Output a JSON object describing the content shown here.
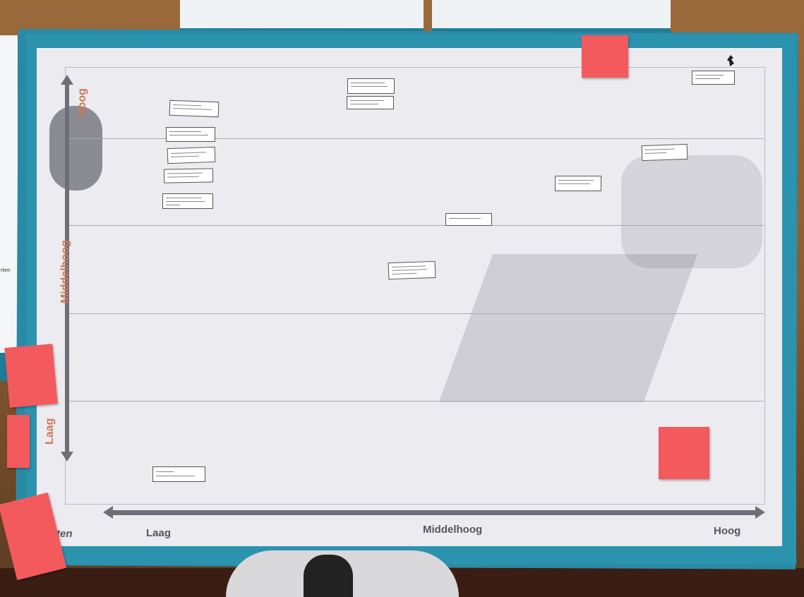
{
  "poster": {
    "y_axis_labels": {
      "high": "Hoog",
      "mid": "Middelhoog",
      "low": "Laag"
    },
    "x_axis_labels": {
      "low": "Laag",
      "mid": "Middelhoog",
      "high": "Hoog"
    },
    "left_fragment": "ten"
  },
  "left_sheet": {
    "fragment": "rken"
  },
  "colors": {
    "teal": "#2c93ae",
    "sticky": "#f25a5e",
    "axis_label": "#c9795a"
  }
}
